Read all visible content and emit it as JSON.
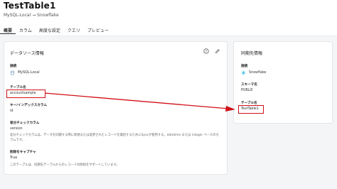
{
  "page": {
    "title": "TestTable1",
    "breadcrumb": "MySQL-Local → Snowflake"
  },
  "tabs": [
    {
      "label": "概要",
      "active": true
    },
    {
      "label": "カラム",
      "active": false
    },
    {
      "label": "高度な設定",
      "active": false
    },
    {
      "label": "クエリ",
      "active": false
    },
    {
      "label": "プレビュー",
      "active": false
    }
  ],
  "source_card": {
    "title": "データソース情報",
    "connection_label": "接続",
    "connection_value": "MySQL-Local",
    "table_label": "テーブル名",
    "table_value": "accountsample",
    "key_label": "キー/インデックスカラム",
    "key_value": "id",
    "diff_label": "差分チェックカラム",
    "diff_value": "version",
    "diff_desc": "差分チェックカラムは、データを同期する際に新規または変更されたレコードを識別するためにSyncが使用する。datetime または integer ベースのカラムです。",
    "delete_label": "削除をキャプチャ",
    "delete_value": "True",
    "delete_desc": "このテーブルは、同期先テーブルからのレコードの削除をサポートしています。"
  },
  "dest_card": {
    "title": "同期先情報",
    "connection_label": "接続",
    "connection_value": "Snowflake",
    "schema_label": "スキーマ名",
    "schema_value": "PUBLIC",
    "table_label": "テーブル名",
    "table_value": "TestTable1"
  },
  "icons": {
    "help": "help-circle-icon",
    "edit": "edit-icon",
    "mysql": "mysql-db-icon",
    "snowflake": "snowflake-icon"
  },
  "colors": {
    "highlight": "#d10f17",
    "snowflake": "#29b5e8"
  }
}
